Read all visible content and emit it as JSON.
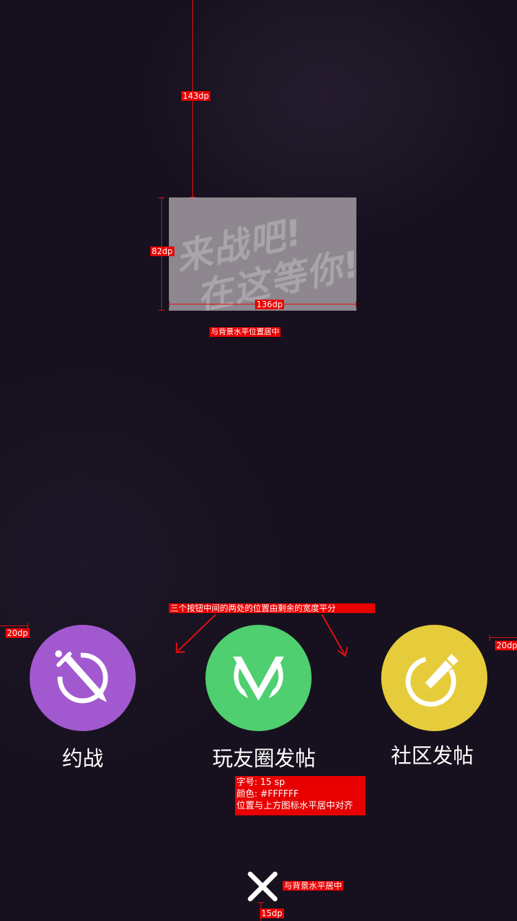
{
  "annotations": {
    "top_gap": "143dp",
    "logo_height": "82dp",
    "logo_width": "136dp",
    "logo_center_note": "与背景水平位置居中",
    "buttons_spacing_note": "三个按钮中间的两处的位置由剩余的宽度平分",
    "left_margin": "20dp",
    "right_margin": "20dp",
    "label_spec": {
      "size": "字号: 15 sp",
      "color": "颜色: #FFFFFF",
      "align": "位置与上方图标水平居中对齐"
    },
    "close_center_note": "与背景水平居中",
    "close_bottom_margin": "15dp"
  },
  "logo": {
    "line1": "来战吧!",
    "line2": "在这等你!"
  },
  "buttons": [
    {
      "label": "约战",
      "color": "#a259d0",
      "icon": "sword-compass-icon"
    },
    {
      "label": "玩友圈发帖",
      "color": "#4fcf6f",
      "icon": "v-badge-icon"
    },
    {
      "label": "社区发帖",
      "color": "#e6cc3b",
      "icon": "pencil-circle-icon"
    }
  ],
  "close": {
    "icon": "close-icon"
  },
  "colors": {
    "background": "#17111f",
    "annotation": "#e80000"
  }
}
